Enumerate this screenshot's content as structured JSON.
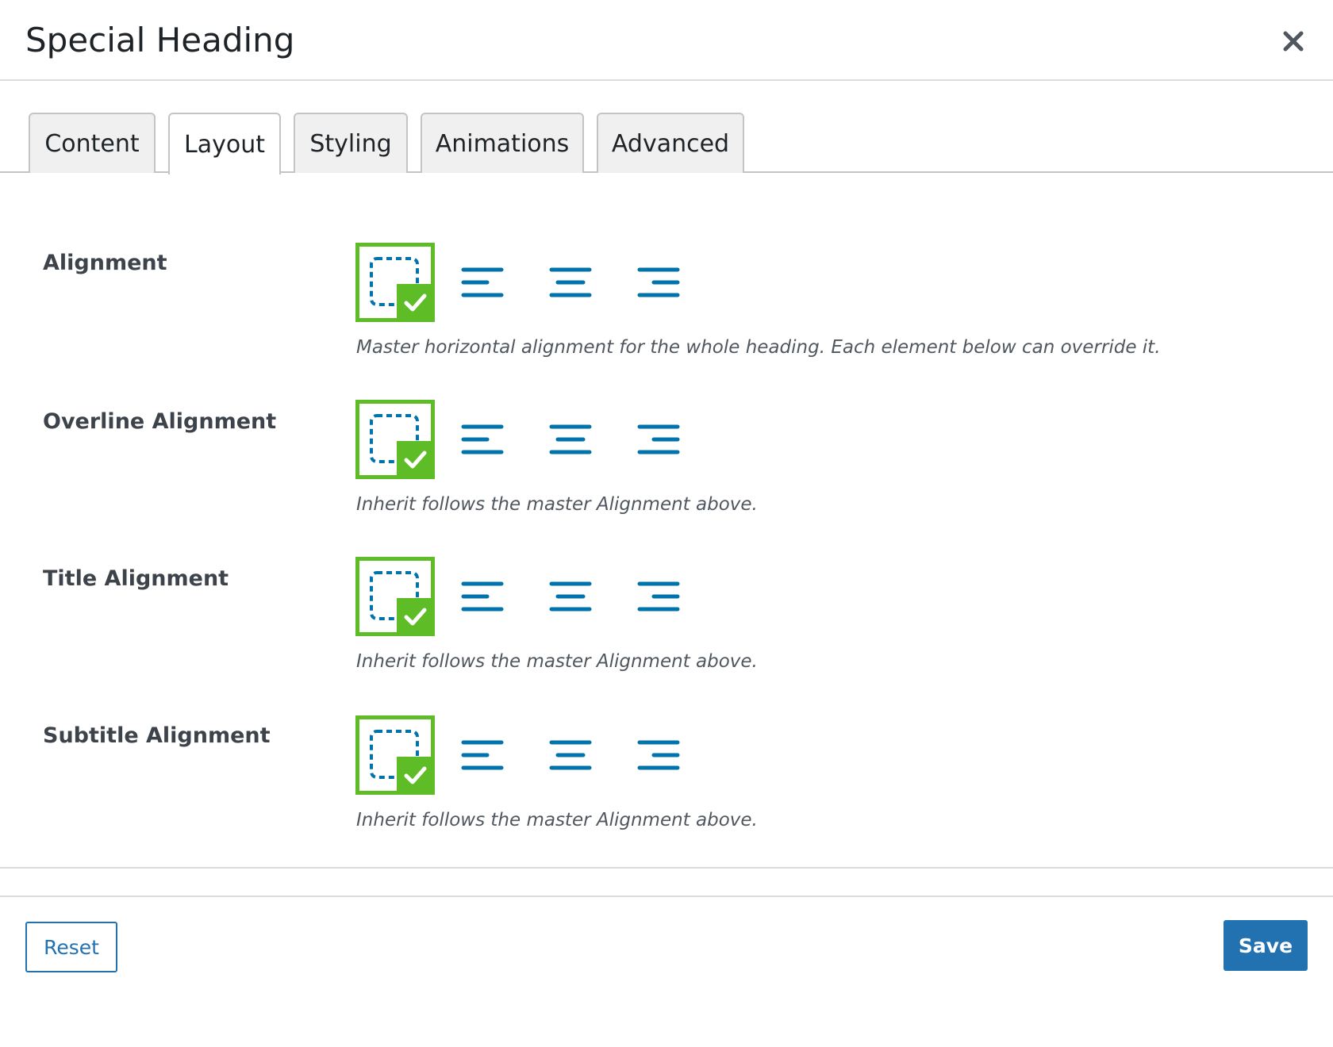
{
  "dialog": {
    "title": "Special Heading",
    "close_icon": "close-icon"
  },
  "tabs": [
    {
      "label": "Content",
      "active": false
    },
    {
      "label": "Layout",
      "active": true
    },
    {
      "label": "Styling",
      "active": false
    },
    {
      "label": "Animations",
      "active": false
    },
    {
      "label": "Advanced",
      "active": false
    }
  ],
  "fields": [
    {
      "label": "Alignment",
      "description": "Master horizontal alignment for the whole heading. Each element below can override it.",
      "selected": "inherit"
    },
    {
      "label": "Overline Alignment",
      "description": "Inherit follows the master Alignment above.",
      "selected": "inherit"
    },
    {
      "label": "Title Alignment",
      "description": "Inherit follows the master Alignment above.",
      "selected": "inherit"
    },
    {
      "label": "Subtitle Alignment",
      "description": "Inherit follows the master Alignment above.",
      "selected": "inherit"
    }
  ],
  "alignment_options": [
    "inherit-icon",
    "align-left-icon",
    "align-center-icon",
    "align-right-icon"
  ],
  "colors": {
    "selected_border": "#5ebd26",
    "icon_blue": "#0073aa",
    "primary_button": "#2271b1"
  },
  "footer": {
    "reset_label": "Reset",
    "save_label": "Save"
  }
}
